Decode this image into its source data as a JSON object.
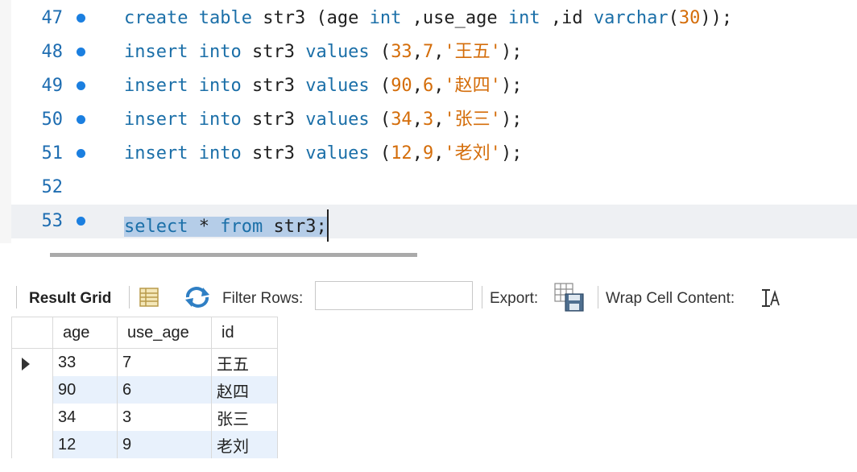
{
  "editor": {
    "lines": [
      {
        "number": "47",
        "has_marker": true,
        "current": false,
        "tokens": [
          [
            "kw",
            "create"
          ],
          [
            "t",
            " "
          ],
          [
            "kw",
            "table"
          ],
          [
            "t",
            " str3 (age "
          ],
          [
            "kw",
            "int"
          ],
          [
            "t",
            " ,use_age "
          ],
          [
            "kw",
            "int"
          ],
          [
            "t",
            " ,id "
          ],
          [
            "kw",
            "varchar"
          ],
          [
            "t",
            "("
          ],
          [
            "num",
            "30"
          ],
          [
            "t",
            "));"
          ]
        ]
      },
      {
        "number": "48",
        "has_marker": true,
        "current": false,
        "tokens": [
          [
            "kw",
            "insert"
          ],
          [
            "t",
            " "
          ],
          [
            "kw",
            "into"
          ],
          [
            "t",
            " str3 "
          ],
          [
            "kw",
            "values"
          ],
          [
            "t",
            " ("
          ],
          [
            "num",
            "33"
          ],
          [
            "t",
            ","
          ],
          [
            "num",
            "7"
          ],
          [
            "t",
            ","
          ],
          [
            "str",
            "'王五'"
          ],
          [
            "t",
            ");"
          ]
        ]
      },
      {
        "number": "49",
        "has_marker": true,
        "current": false,
        "tokens": [
          [
            "kw",
            "insert"
          ],
          [
            "t",
            " "
          ],
          [
            "kw",
            "into"
          ],
          [
            "t",
            " str3 "
          ],
          [
            "kw",
            "values"
          ],
          [
            "t",
            " ("
          ],
          [
            "num",
            "90"
          ],
          [
            "t",
            ","
          ],
          [
            "num",
            "6"
          ],
          [
            "t",
            ","
          ],
          [
            "str",
            "'赵四'"
          ],
          [
            "t",
            ");"
          ]
        ]
      },
      {
        "number": "50",
        "has_marker": true,
        "current": false,
        "tokens": [
          [
            "kw",
            "insert"
          ],
          [
            "t",
            " "
          ],
          [
            "kw",
            "into"
          ],
          [
            "t",
            " str3 "
          ],
          [
            "kw",
            "values"
          ],
          [
            "t",
            " ("
          ],
          [
            "num",
            "34"
          ],
          [
            "t",
            ","
          ],
          [
            "num",
            "3"
          ],
          [
            "t",
            ","
          ],
          [
            "str",
            "'张三'"
          ],
          [
            "t",
            ");"
          ]
        ]
      },
      {
        "number": "51",
        "has_marker": true,
        "current": false,
        "tokens": [
          [
            "kw",
            "insert"
          ],
          [
            "t",
            " "
          ],
          [
            "kw",
            "into"
          ],
          [
            "t",
            " str3 "
          ],
          [
            "kw",
            "values"
          ],
          [
            "t",
            " ("
          ],
          [
            "num",
            "12"
          ],
          [
            "t",
            ","
          ],
          [
            "num",
            "9"
          ],
          [
            "t",
            ","
          ],
          [
            "str",
            "'老刘'"
          ],
          [
            "t",
            ");"
          ]
        ]
      },
      {
        "number": "52",
        "has_marker": false,
        "current": false,
        "tokens": []
      },
      {
        "number": "53",
        "has_marker": true,
        "current": true,
        "selected": true,
        "tokens": [
          [
            "kw",
            "select"
          ],
          [
            "t",
            " * "
          ],
          [
            "kw",
            "from"
          ],
          [
            "t",
            " str3;"
          ]
        ]
      }
    ]
  },
  "toolbar": {
    "result_grid_label": "Result Grid",
    "filter_rows_label": "Filter Rows:",
    "filter_value": "",
    "export_label": "Export:",
    "wrap_label": "Wrap Cell Content:"
  },
  "grid": {
    "columns": [
      "age",
      "use_age",
      "id"
    ],
    "rows": [
      [
        "33",
        "7",
        "王五"
      ],
      [
        "90",
        "6",
        "赵四"
      ],
      [
        "34",
        "3",
        "张三"
      ],
      [
        "12",
        "9",
        "老刘"
      ]
    ],
    "selected_row": 0
  },
  "icons": {
    "form-editor": "form-editor-icon",
    "refresh": "refresh-icon",
    "export": "export-icon",
    "wrap": "wrap-text-icon"
  }
}
